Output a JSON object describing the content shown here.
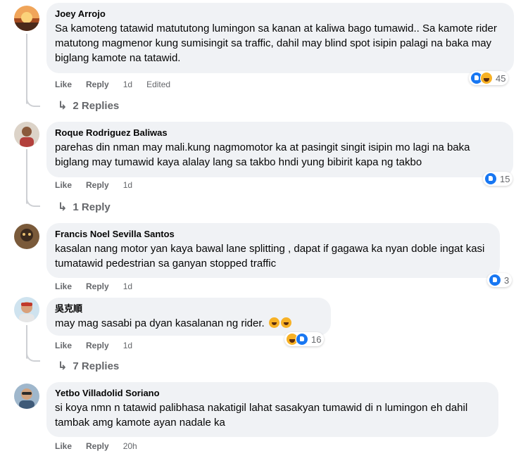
{
  "comments": [
    {
      "author": "Joey Arrojo",
      "text": "Sa kamoteng tatawid matututong lumingon sa kanan at kaliwa bago tumawid.. Sa kamote rider matutong magmenor kung sumisingit sa traffic, dahil may blind spot isipin palagi na baka may biglang kamote na tatawid.",
      "like": "Like",
      "reply": "Reply",
      "time": "1d",
      "edited": "Edited",
      "reactions": "45",
      "replies": "2 Replies",
      "avatar_color": "#c9692d"
    },
    {
      "author": "Roque Rodriguez Baliwas",
      "text": "parehas din nman may mali.kung nagmomotor ka at pasingit singit isipin mo lagi na baka biglang may tumawid kaya alalay lang sa takbo hndi yung bibirit kapa ng takbo",
      "like": "Like",
      "reply": "Reply",
      "time": "1d",
      "reactions": "15",
      "replies": "1 Reply",
      "avatar_color": "#b3403c"
    },
    {
      "author": "Francis Noel Sevilla Santos",
      "text": "kasalan nang motor yan kaya bawal lane splitting , dapat if gagawa ka nyan doble ingat kasi tumatawid pedestrian sa ganyan stopped traffic",
      "like": "Like",
      "reply": "Reply",
      "time": "1d",
      "reactions": "3",
      "avatar_color": "#6b4a2e"
    },
    {
      "author": "吳克順",
      "text": "may mag sasabi pa dyan kasalanan ng rider.",
      "like": "Like",
      "reply": "Reply",
      "time": "1d",
      "reactions": "16",
      "replies": "7 Replies",
      "avatar_color": "#b98b6a"
    },
    {
      "author": "Yetbo Villadolid Soriano",
      "text": "si koya nmn n tatawid palibhasa nakatigil lahat sasakyan tumawid di n lumingon eh dahil tambak amg kamote ayan nadale ka",
      "like": "Like",
      "reply": "Reply",
      "time": "20h",
      "avatar_color": "#6f8aa6"
    }
  ],
  "colors": {
    "like_blue": "#1877f2",
    "haha_yellow": "#f7b125",
    "bubble_gray": "#f0f2f5",
    "meta_gray": "#65676b"
  }
}
